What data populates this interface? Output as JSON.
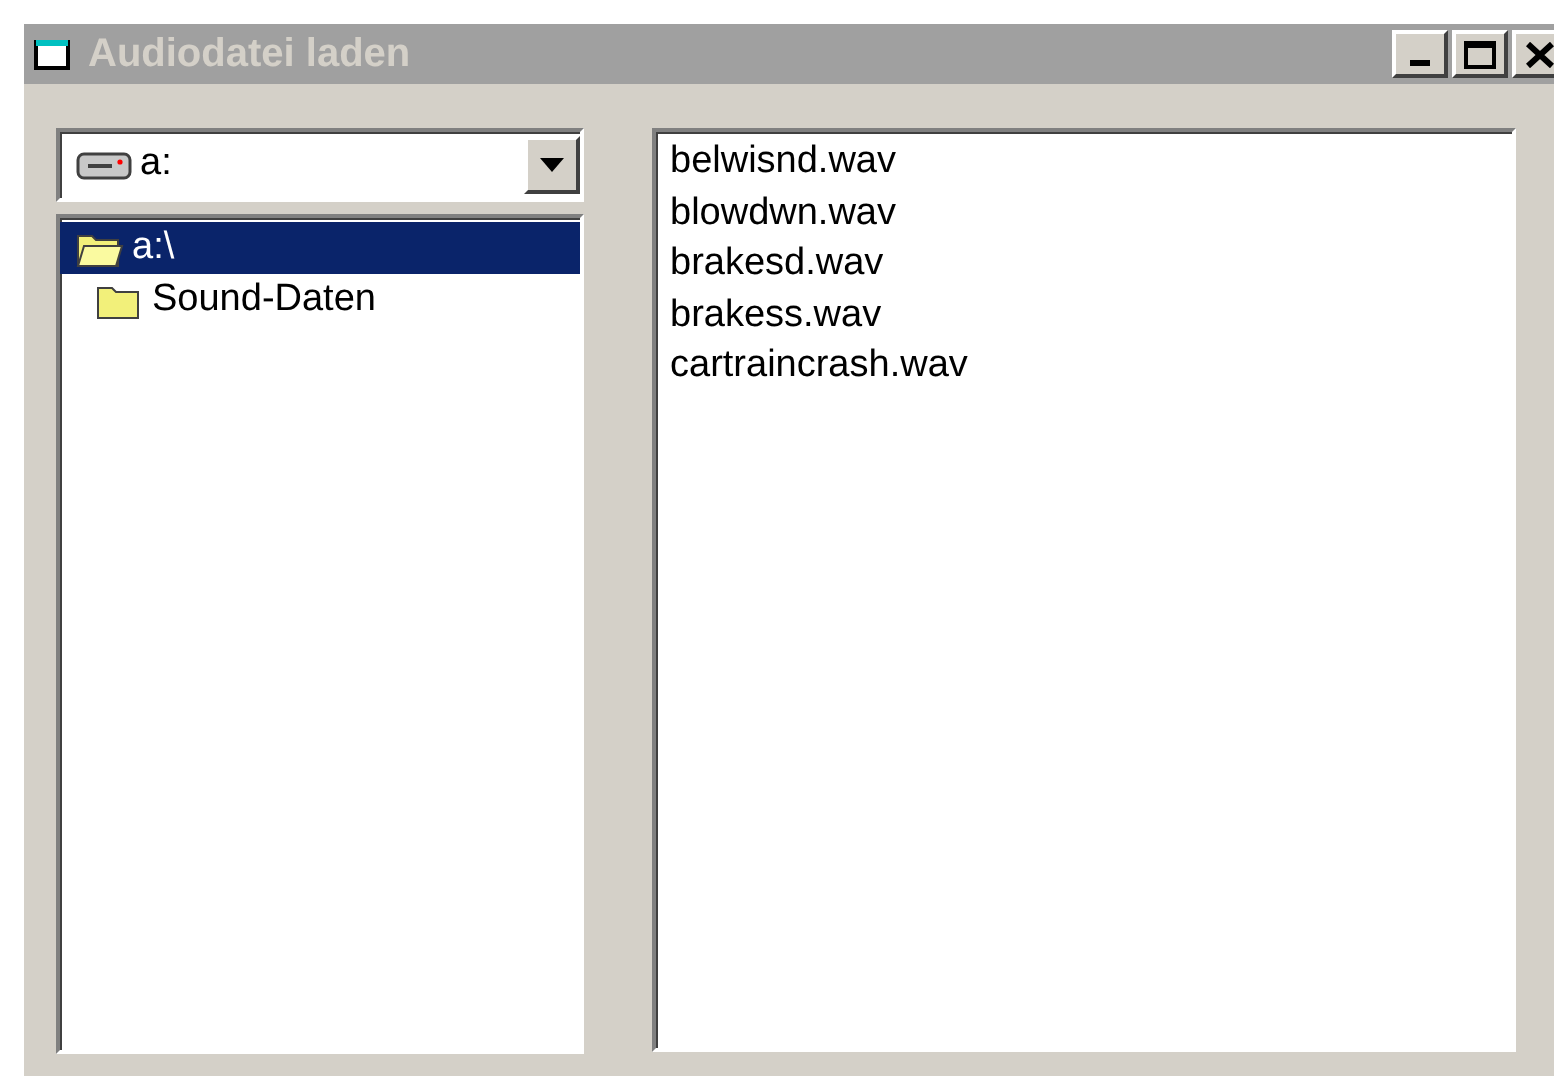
{
  "window": {
    "title": "Audiodatei laden",
    "active": false
  },
  "drive_combo": {
    "value": "a:"
  },
  "folder_tree": [
    {
      "label": "a:\\",
      "selected": true,
      "open": true,
      "children": [
        {
          "label": "Sound-Daten",
          "selected": false,
          "open": false
        }
      ]
    }
  ],
  "file_list": [
    {
      "label": "belwisnd.wav",
      "selected": false
    },
    {
      "label": "blowdwn.wav",
      "selected": false
    },
    {
      "label": "brakesd.wav",
      "selected": false
    },
    {
      "label": "brakess.wav",
      "selected": false
    },
    {
      "label": "cartraincrash.wav",
      "selected": false
    }
  ]
}
